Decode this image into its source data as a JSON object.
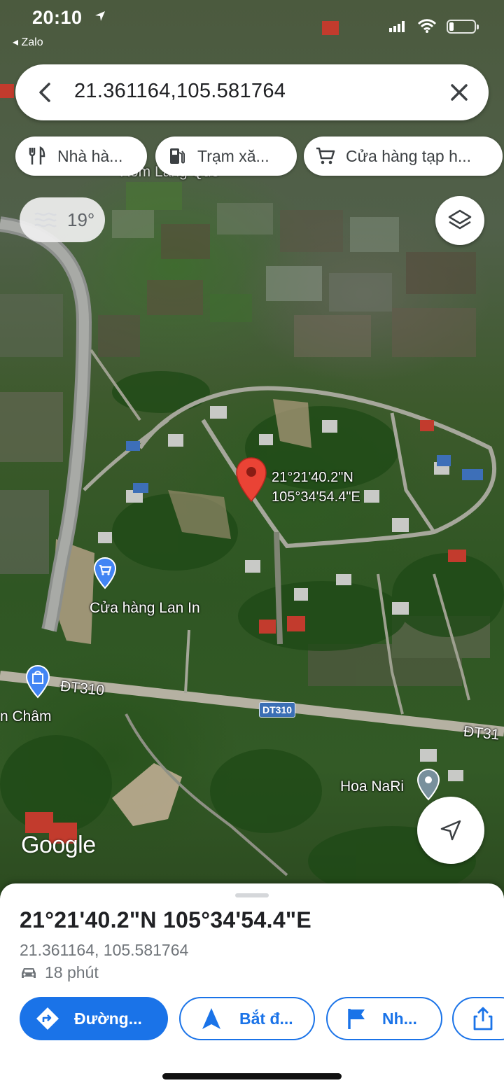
{
  "status_bar": {
    "time": "20:10",
    "back_app": "◂ Zalo",
    "icons": [
      "location-arrow-icon",
      "signal-icon",
      "wifi-icon",
      "battery-icon"
    ],
    "battery_level": 0.15
  },
  "search": {
    "query": "21.361164,105.581764",
    "icons": [
      "back-arrow-icon",
      "close-icon"
    ]
  },
  "chips": [
    {
      "label": "Nhà hà...",
      "icon": "restaurant-icon"
    },
    {
      "label": "Trạm xă...",
      "icon": "gas-station-icon"
    },
    {
      "label": "Cửa hàng tạp h...",
      "icon": "shopping-cart-icon"
    }
  ],
  "weather": {
    "temp": "19°",
    "icon": "haze-icon"
  },
  "map": {
    "labels": {
      "village": "Xóm Láng Quê",
      "shop_lan_in": "Cửa hàng Lan In",
      "road_dt310_a": "ĐT310",
      "road_dt310_b": "ĐT31",
      "cham": "n Châm",
      "hoa_nari": "Hoa NaRi",
      "shield": "DT310"
    },
    "pin": {
      "lat_dms": "21°21'40.2\"N",
      "lng_dms": "105°34'54.4\"E",
      "color": "#ea4335"
    },
    "attribution": "Google"
  },
  "sheet": {
    "title": "21°21'40.2\"N 105°34'54.4\"E",
    "coords": "21.361164, 105.581764",
    "eta": "18 phút",
    "actions": {
      "directions": "Đường...",
      "start": "Bắt đ...",
      "save": "Nh...",
      "share": ""
    },
    "accent": "#1a73e8"
  }
}
